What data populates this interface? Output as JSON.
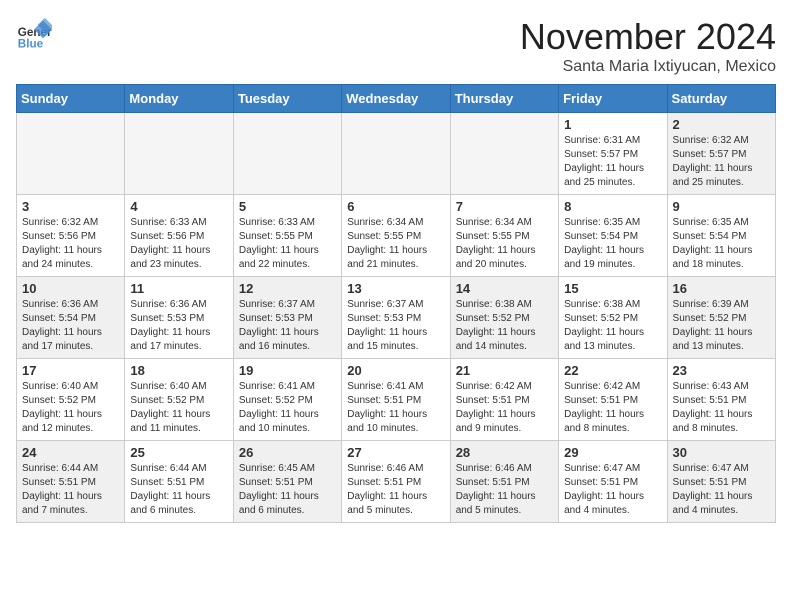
{
  "logo": {
    "general": "General",
    "blue": "Blue"
  },
  "header": {
    "month": "November 2024",
    "location": "Santa Maria Ixtiyucan, Mexico"
  },
  "days_of_week": [
    "Sunday",
    "Monday",
    "Tuesday",
    "Wednesday",
    "Thursday",
    "Friday",
    "Saturday"
  ],
  "weeks": [
    [
      {
        "day": "",
        "info": "",
        "empty": true
      },
      {
        "day": "",
        "info": "",
        "empty": true
      },
      {
        "day": "",
        "info": "",
        "empty": true
      },
      {
        "day": "",
        "info": "",
        "empty": true
      },
      {
        "day": "",
        "info": "",
        "empty": true
      },
      {
        "day": "1",
        "info": "Sunrise: 6:31 AM\nSunset: 5:57 PM\nDaylight: 11 hours and 25 minutes."
      },
      {
        "day": "2",
        "info": "Sunrise: 6:32 AM\nSunset: 5:57 PM\nDaylight: 11 hours and 25 minutes."
      }
    ],
    [
      {
        "day": "3",
        "info": "Sunrise: 6:32 AM\nSunset: 5:56 PM\nDaylight: 11 hours and 24 minutes."
      },
      {
        "day": "4",
        "info": "Sunrise: 6:33 AM\nSunset: 5:56 PM\nDaylight: 11 hours and 23 minutes."
      },
      {
        "day": "5",
        "info": "Sunrise: 6:33 AM\nSunset: 5:55 PM\nDaylight: 11 hours and 22 minutes."
      },
      {
        "day": "6",
        "info": "Sunrise: 6:34 AM\nSunset: 5:55 PM\nDaylight: 11 hours and 21 minutes."
      },
      {
        "day": "7",
        "info": "Sunrise: 6:34 AM\nSunset: 5:55 PM\nDaylight: 11 hours and 20 minutes."
      },
      {
        "day": "8",
        "info": "Sunrise: 6:35 AM\nSunset: 5:54 PM\nDaylight: 11 hours and 19 minutes."
      },
      {
        "day": "9",
        "info": "Sunrise: 6:35 AM\nSunset: 5:54 PM\nDaylight: 11 hours and 18 minutes."
      }
    ],
    [
      {
        "day": "10",
        "info": "Sunrise: 6:36 AM\nSunset: 5:54 PM\nDaylight: 11 hours and 17 minutes."
      },
      {
        "day": "11",
        "info": "Sunrise: 6:36 AM\nSunset: 5:53 PM\nDaylight: 11 hours and 17 minutes."
      },
      {
        "day": "12",
        "info": "Sunrise: 6:37 AM\nSunset: 5:53 PM\nDaylight: 11 hours and 16 minutes."
      },
      {
        "day": "13",
        "info": "Sunrise: 6:37 AM\nSunset: 5:53 PM\nDaylight: 11 hours and 15 minutes."
      },
      {
        "day": "14",
        "info": "Sunrise: 6:38 AM\nSunset: 5:52 PM\nDaylight: 11 hours and 14 minutes."
      },
      {
        "day": "15",
        "info": "Sunrise: 6:38 AM\nSunset: 5:52 PM\nDaylight: 11 hours and 13 minutes."
      },
      {
        "day": "16",
        "info": "Sunrise: 6:39 AM\nSunset: 5:52 PM\nDaylight: 11 hours and 13 minutes."
      }
    ],
    [
      {
        "day": "17",
        "info": "Sunrise: 6:40 AM\nSunset: 5:52 PM\nDaylight: 11 hours and 12 minutes."
      },
      {
        "day": "18",
        "info": "Sunrise: 6:40 AM\nSunset: 5:52 PM\nDaylight: 11 hours and 11 minutes."
      },
      {
        "day": "19",
        "info": "Sunrise: 6:41 AM\nSunset: 5:52 PM\nDaylight: 11 hours and 10 minutes."
      },
      {
        "day": "20",
        "info": "Sunrise: 6:41 AM\nSunset: 5:51 PM\nDaylight: 11 hours and 10 minutes."
      },
      {
        "day": "21",
        "info": "Sunrise: 6:42 AM\nSunset: 5:51 PM\nDaylight: 11 hours and 9 minutes."
      },
      {
        "day": "22",
        "info": "Sunrise: 6:42 AM\nSunset: 5:51 PM\nDaylight: 11 hours and 8 minutes."
      },
      {
        "day": "23",
        "info": "Sunrise: 6:43 AM\nSunset: 5:51 PM\nDaylight: 11 hours and 8 minutes."
      }
    ],
    [
      {
        "day": "24",
        "info": "Sunrise: 6:44 AM\nSunset: 5:51 PM\nDaylight: 11 hours and 7 minutes."
      },
      {
        "day": "25",
        "info": "Sunrise: 6:44 AM\nSunset: 5:51 PM\nDaylight: 11 hours and 6 minutes."
      },
      {
        "day": "26",
        "info": "Sunrise: 6:45 AM\nSunset: 5:51 PM\nDaylight: 11 hours and 6 minutes."
      },
      {
        "day": "27",
        "info": "Sunrise: 6:46 AM\nSunset: 5:51 PM\nDaylight: 11 hours and 5 minutes."
      },
      {
        "day": "28",
        "info": "Sunrise: 6:46 AM\nSunset: 5:51 PM\nDaylight: 11 hours and 5 minutes."
      },
      {
        "day": "29",
        "info": "Sunrise: 6:47 AM\nSunset: 5:51 PM\nDaylight: 11 hours and 4 minutes."
      },
      {
        "day": "30",
        "info": "Sunrise: 6:47 AM\nSunset: 5:51 PM\nDaylight: 11 hours and 4 minutes."
      }
    ]
  ]
}
